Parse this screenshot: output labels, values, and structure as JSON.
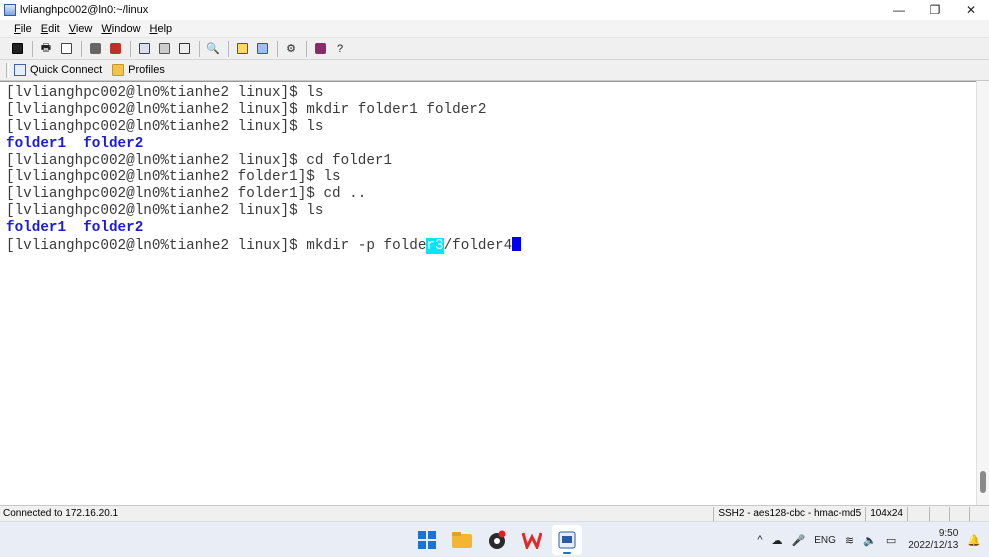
{
  "window": {
    "title": "lvlianghpc002@ln0:~/linux",
    "minimize_glyph": "—",
    "maximize_glyph": "❐",
    "close_glyph": "✕"
  },
  "menu": {
    "items": [
      {
        "accel": "F",
        "rest": "ile"
      },
      {
        "accel": "E",
        "rest": "dit"
      },
      {
        "accel": "V",
        "rest": "iew"
      },
      {
        "accel": "W",
        "rest": "indow"
      },
      {
        "accel": "H",
        "rest": "elp"
      }
    ]
  },
  "toolbar": {
    "icons": [
      "save-icon",
      "print-icon",
      "print-preview-icon",
      "connect-icon",
      "disconnect-icon",
      "copy-icon",
      "paste-icon",
      "clipboard-icon",
      "find-icon",
      "sftp-icon",
      "transfer-icon",
      "options-icon",
      "keymap-icon",
      "help-icon"
    ]
  },
  "linkbar": {
    "quick_connect": "Quick Connect",
    "profiles": "Profiles"
  },
  "terminal": {
    "lines": [
      {
        "text": "[lvlianghpc002@ln0%tianhe2 linux]$ ls"
      },
      {
        "text": "[lvlianghpc002@ln0%tianhe2 linux]$ mkdir folder1 folder2"
      },
      {
        "text": "[lvlianghpc002@ln0%tianhe2 linux]$ ls"
      },
      {
        "text": "folder1  folder2",
        "dir": true
      },
      {
        "text": "[lvlianghpc002@ln0%tianhe2 linux]$ cd folder1"
      },
      {
        "text": "[lvlianghpc002@ln0%tianhe2 folder1]$ ls"
      },
      {
        "text": "[lvlianghpc002@ln0%tianhe2 folder1]$ cd .."
      },
      {
        "text": "[lvlianghpc002@ln0%tianhe2 linux]$ ls"
      },
      {
        "text": "folder1  folder2",
        "dir": true
      }
    ],
    "current_prompt": "[lvlianghpc002@ln0%tianhe2 linux]$ mkdir -p folde",
    "current_highlight": "r3",
    "current_rest": "/folder4"
  },
  "status": {
    "connection": "Connected to 172.16.20.1",
    "protocol": "SSH2 - aes128-cbc - hmac-md5",
    "size": "104x24"
  },
  "taskbar": {
    "apps": [
      "windows-start-icon",
      "file-explorer-icon",
      "media-app-icon",
      "wps-office-icon",
      "securecrt-icon"
    ],
    "tray": {
      "chevron": "^",
      "lang": "ENG",
      "time": "9:50",
      "date": "2022/12/13"
    }
  },
  "colors": {
    "terminal_text": "#3a3a3a",
    "directory_text": "#1a1ae0",
    "highlight": "#00e6ff",
    "cursor": "#0000ee"
  }
}
